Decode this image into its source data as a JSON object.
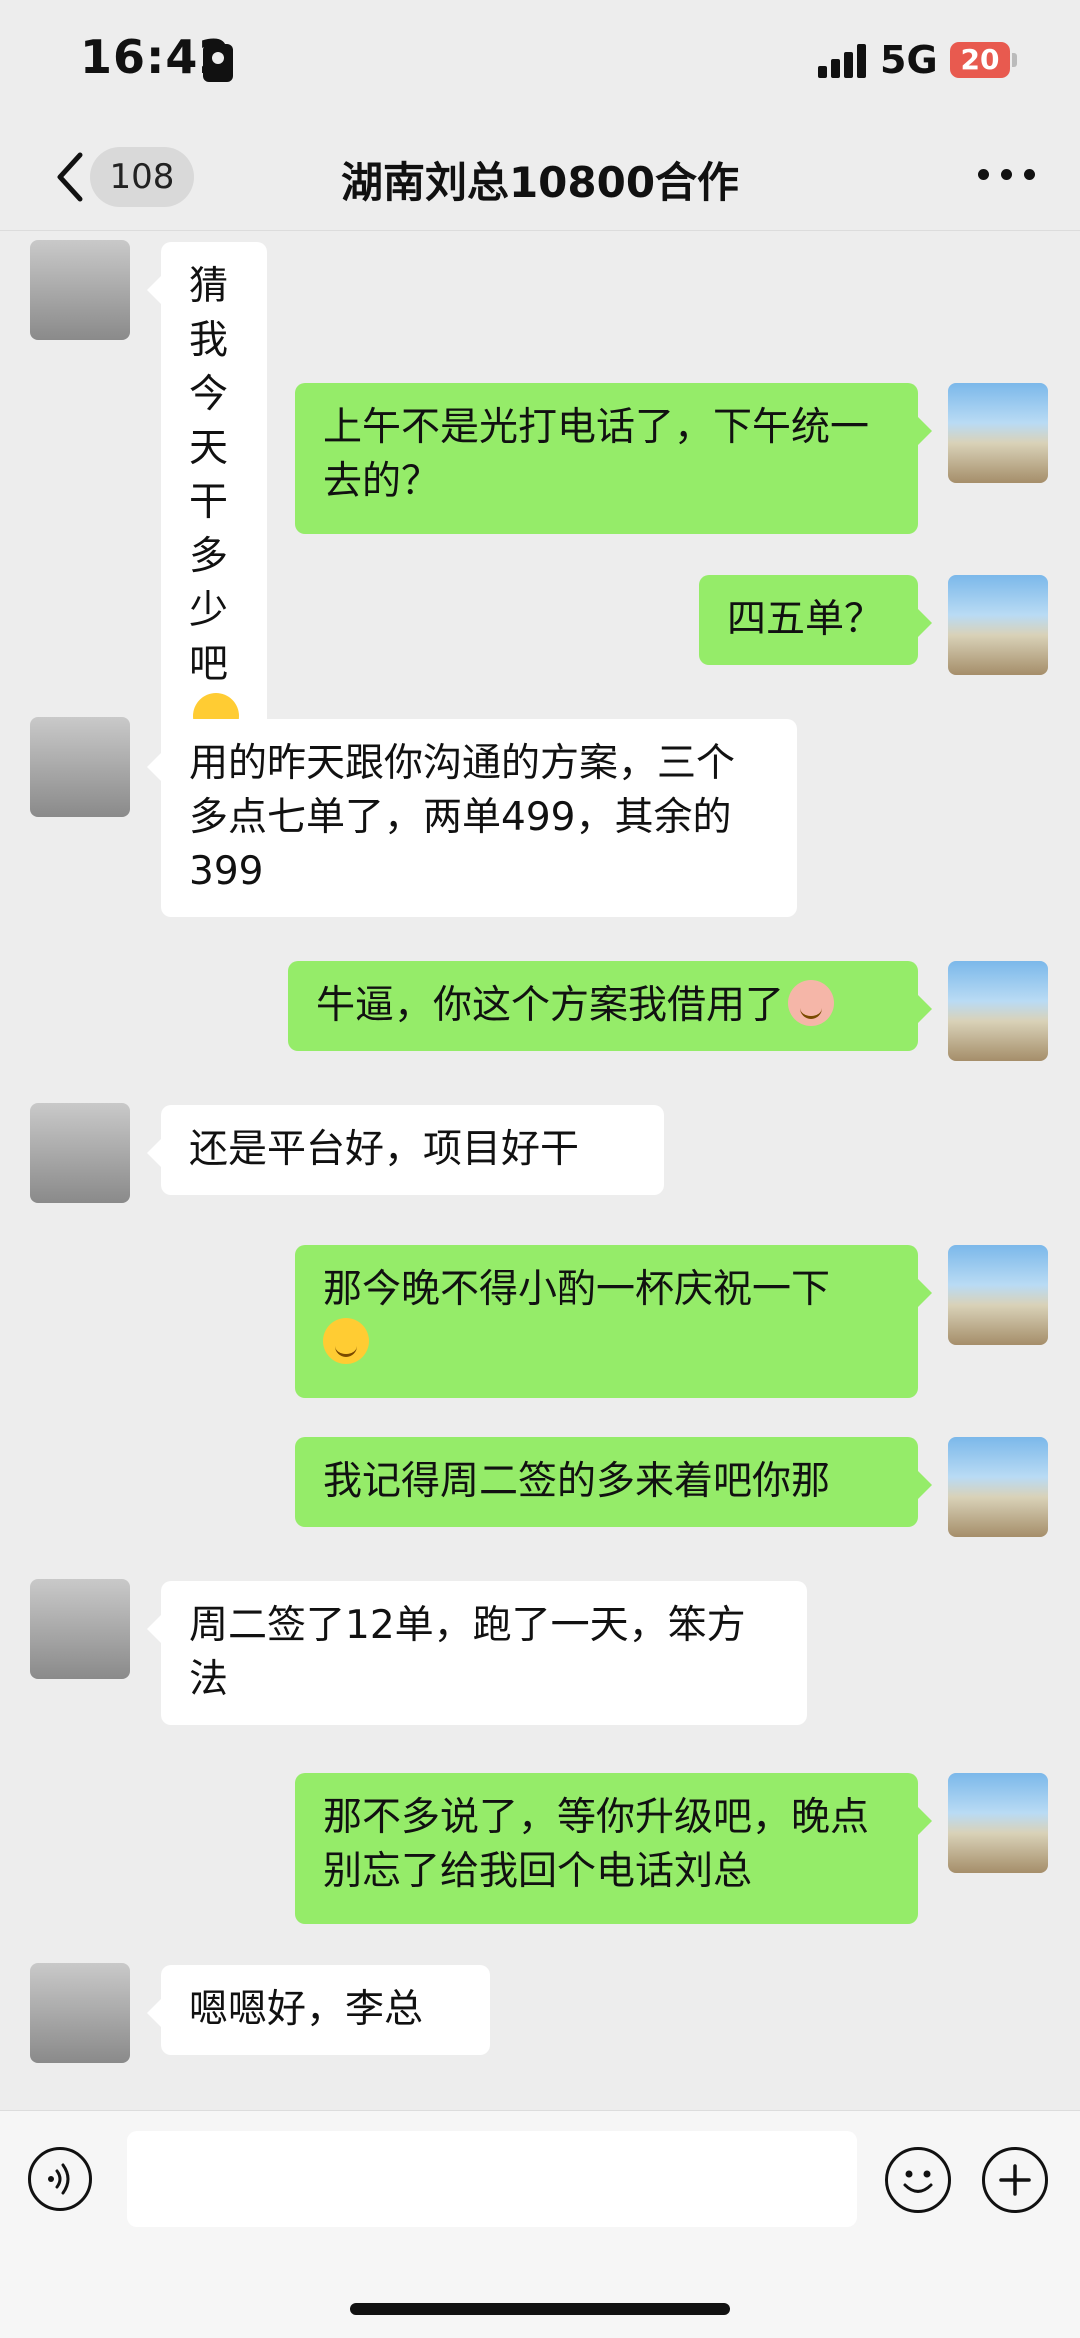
{
  "status_bar": {
    "time": "16:42",
    "network": "5G",
    "battery": "20"
  },
  "nav": {
    "back_badge": "108",
    "title": "湖南刘总10800合作"
  },
  "messages": [
    {
      "from": "other",
      "text": "猜我今天干多少吧"
    },
    {
      "from": "me",
      "text": "上午不是光打电话了，下午统一去的？"
    },
    {
      "from": "me",
      "text": "四五单？"
    },
    {
      "from": "other",
      "text": "用的昨天跟你沟通的方案，三个多点七单了，两单499，其余的399"
    },
    {
      "from": "me",
      "text": "牛逼，你这个方案我借用了"
    },
    {
      "from": "other",
      "text": "还是平台好，项目好干"
    },
    {
      "from": "me",
      "text": "那今晚不得小酌一杯庆祝一下"
    },
    {
      "from": "me",
      "text": "我记得周二签的多来着吧你那"
    },
    {
      "from": "other",
      "text": "周二签了12单，跑了一天，笨方法"
    },
    {
      "from": "me",
      "text": "那不多说了，等你升级吧，晚点别忘了给我回个电话刘总"
    },
    {
      "from": "other",
      "text": "嗯嗯好，李总"
    }
  ],
  "icons": {
    "back": "chevron-left-icon",
    "more": "ellipsis-icon",
    "voice": "voice-icon",
    "emoji": "smiley-icon",
    "plus": "plus-icon"
  },
  "colors": {
    "background": "#ededed",
    "my_bubble": "#95ec69",
    "their_bubble": "#ffffff",
    "battery": "#e85a4f"
  }
}
